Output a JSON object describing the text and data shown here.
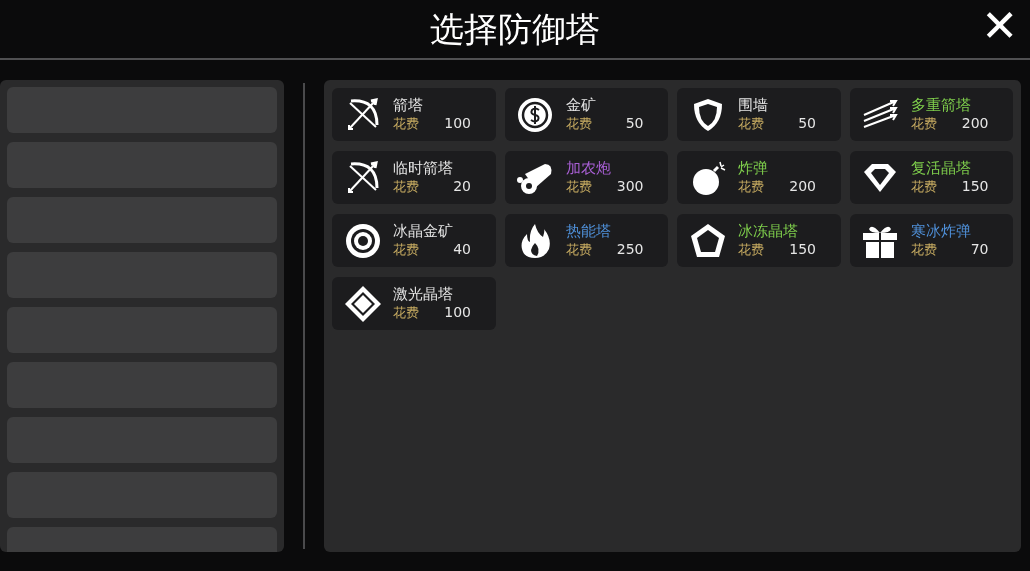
{
  "title": "选择防御塔",
  "close": "✕",
  "towers": [
    {
      "name": "箭塔",
      "color": "#e6e6e6",
      "cost_label": "花费",
      "cost": "100",
      "kind": "bow"
    },
    {
      "name": "金矿",
      "color": "#e6e6e6",
      "cost_label": "花费",
      "cost": "50",
      "kind": "coin"
    },
    {
      "name": "围墙",
      "color": "#e6e6e6",
      "cost_label": "花费",
      "cost": "50",
      "kind": "shield"
    },
    {
      "name": "多重箭塔",
      "color": "#7fcf4c",
      "cost_label": "花费",
      "cost": "200",
      "kind": "arrows"
    },
    {
      "name": "临时箭塔",
      "color": "#e6e6e6",
      "cost_label": "花费",
      "cost": "20",
      "kind": "bow"
    },
    {
      "name": "加农炮",
      "color": "#a85fd4",
      "cost_label": "花费",
      "cost": "300",
      "kind": "cannon"
    },
    {
      "name": "炸弹",
      "color": "#7fcf4c",
      "cost_label": "花费",
      "cost": "200",
      "kind": "bomb"
    },
    {
      "name": "复活晶塔",
      "color": "#7fcf4c",
      "cost_label": "花费",
      "cost": "150",
      "kind": "gem"
    },
    {
      "name": "冰晶金矿",
      "color": "#e6e6e6",
      "cost_label": "花费",
      "cost": "40",
      "kind": "ring"
    },
    {
      "name": "热能塔",
      "color": "#4f90d9",
      "cost_label": "花费",
      "cost": "250",
      "kind": "flame"
    },
    {
      "name": "冰冻晶塔",
      "color": "#7fcf4c",
      "cost_label": "花费",
      "cost": "150",
      "kind": "pentagon"
    },
    {
      "name": "寒冰炸弹",
      "color": "#4f90d9",
      "cost_label": "花费",
      "cost": "70",
      "kind": "gift"
    },
    {
      "name": "激光晶塔",
      "color": "#e6e6e6",
      "cost_label": "花费",
      "cost": "100",
      "kind": "diamond"
    }
  ]
}
